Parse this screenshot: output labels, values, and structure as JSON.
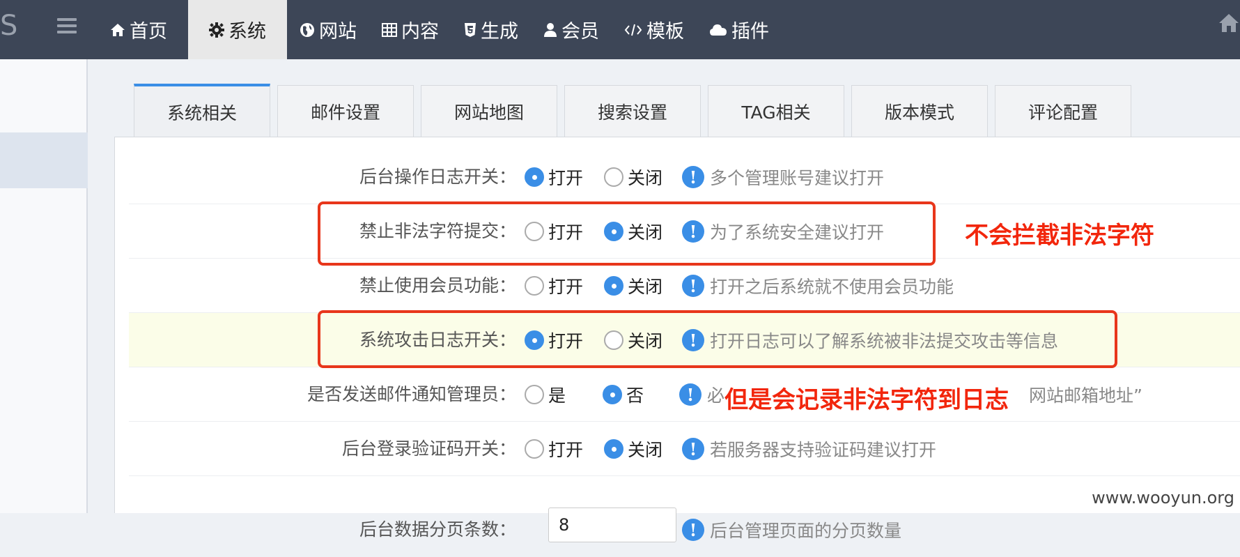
{
  "nav": {
    "logo": "S",
    "items": [
      {
        "label": "首页",
        "icon": "home-icon"
      },
      {
        "label": "系统",
        "icon": "gear-icon"
      },
      {
        "label": "网站",
        "icon": "globe-icon"
      },
      {
        "label": "内容",
        "icon": "table-icon"
      },
      {
        "label": "生成",
        "icon": "html5-icon"
      },
      {
        "label": "会员",
        "icon": "user-icon"
      },
      {
        "label": "模板",
        "icon": "code-icon"
      },
      {
        "label": "插件",
        "icon": "cloud-icon"
      }
    ],
    "active_index": 1
  },
  "tabs": [
    "系统相关",
    "邮件设置",
    "网站地图",
    "搜索设置",
    "TAG相关",
    "版本模式",
    "评论配置"
  ],
  "settings": [
    {
      "label": "后台操作日志开关：",
      "opt1": "打开",
      "opt2": "关闭",
      "selected": 1,
      "hint": "多个管理账号建议打开"
    },
    {
      "label": "禁止非法字符提交：",
      "opt1": "打开",
      "opt2": "关闭",
      "selected": 2,
      "hint": "为了系统安全建议打开"
    },
    {
      "label": "禁止使用会员功能：",
      "opt1": "打开",
      "opt2": "关闭",
      "selected": 2,
      "hint": "打开之后系统就不使用会员功能"
    },
    {
      "label": "系统攻击日志开关：",
      "opt1": "打开",
      "opt2": "关闭",
      "selected": 1,
      "hint": "打开日志可以了解系统被非法提交攻击等信息"
    },
    {
      "label": "是否发送邮件通知管理员：",
      "opt1": "是",
      "opt2": "否",
      "selected": 2,
      "hint_prefix": "必",
      "hint_suffix": "网站邮箱地址”"
    },
    {
      "label": "后台登录验证码开关：",
      "opt1": "打开",
      "opt2": "关闭",
      "selected": 2,
      "hint": "若服务器支持验证码建议打开"
    },
    {
      "label": "后台数据分页条数：",
      "value": "8",
      "hint": "后台管理页面的分页数量"
    }
  ],
  "annotations": {
    "note1": "不会拦截非法字符",
    "note2": "但是会记录非法字符到日志"
  },
  "watermark": "www.wooyun.org",
  "colors": {
    "accent": "#3a8ee6",
    "topbar": "#3d4657",
    "annotation": "#e8361b"
  }
}
